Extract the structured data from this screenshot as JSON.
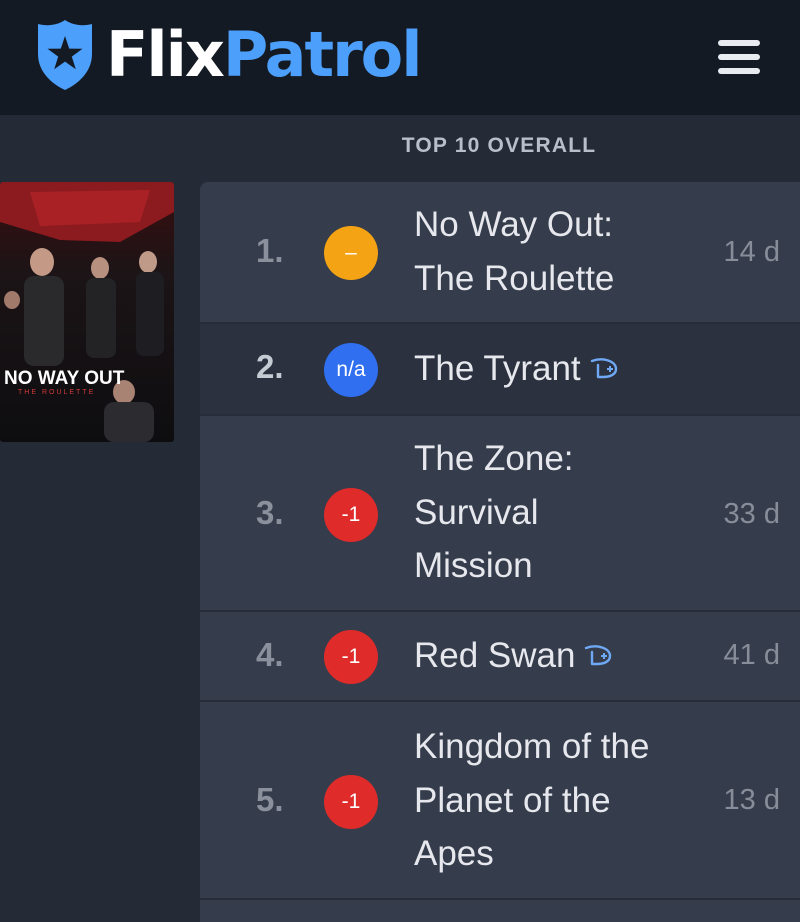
{
  "header": {
    "logo_part1": "Flix",
    "logo_part2": "Patrol",
    "logo_icon": "police-badge-star-icon",
    "menu_icon": "hamburger-menu-icon"
  },
  "section": {
    "title": "TOP 10 OVERALL"
  },
  "poster": {
    "title": "NO WAY OUT",
    "subtitle": "THE ROULETTE"
  },
  "colors": {
    "accent": "#4c9ffb",
    "up_none": "#f4a314",
    "new": "#2f6ff0",
    "down": "#e02b2b",
    "disney_icon": "#6fa9f5"
  },
  "rows": [
    {
      "rank": "1.",
      "change": "–",
      "title_lines": [
        "No Way Out:",
        "The Roulette"
      ],
      "days": "14 d",
      "disney": false
    },
    {
      "rank": "2.",
      "change": "n/a",
      "title_lines": [
        "The Tyrant"
      ],
      "days": "",
      "disney": true
    },
    {
      "rank": "3.",
      "change": "-1",
      "title_lines": [
        "The Zone:",
        "Survival",
        "Mission"
      ],
      "days": "33 d",
      "disney": false
    },
    {
      "rank": "4.",
      "change": "-1",
      "title_lines": [
        "Red Swan"
      ],
      "days": "41 d",
      "disney": true
    },
    {
      "rank": "5.",
      "change": "-1",
      "title_lines": [
        "Kingdom of the",
        "Planet of the",
        "Apes"
      ],
      "days": "13 d",
      "disney": false
    }
  ]
}
